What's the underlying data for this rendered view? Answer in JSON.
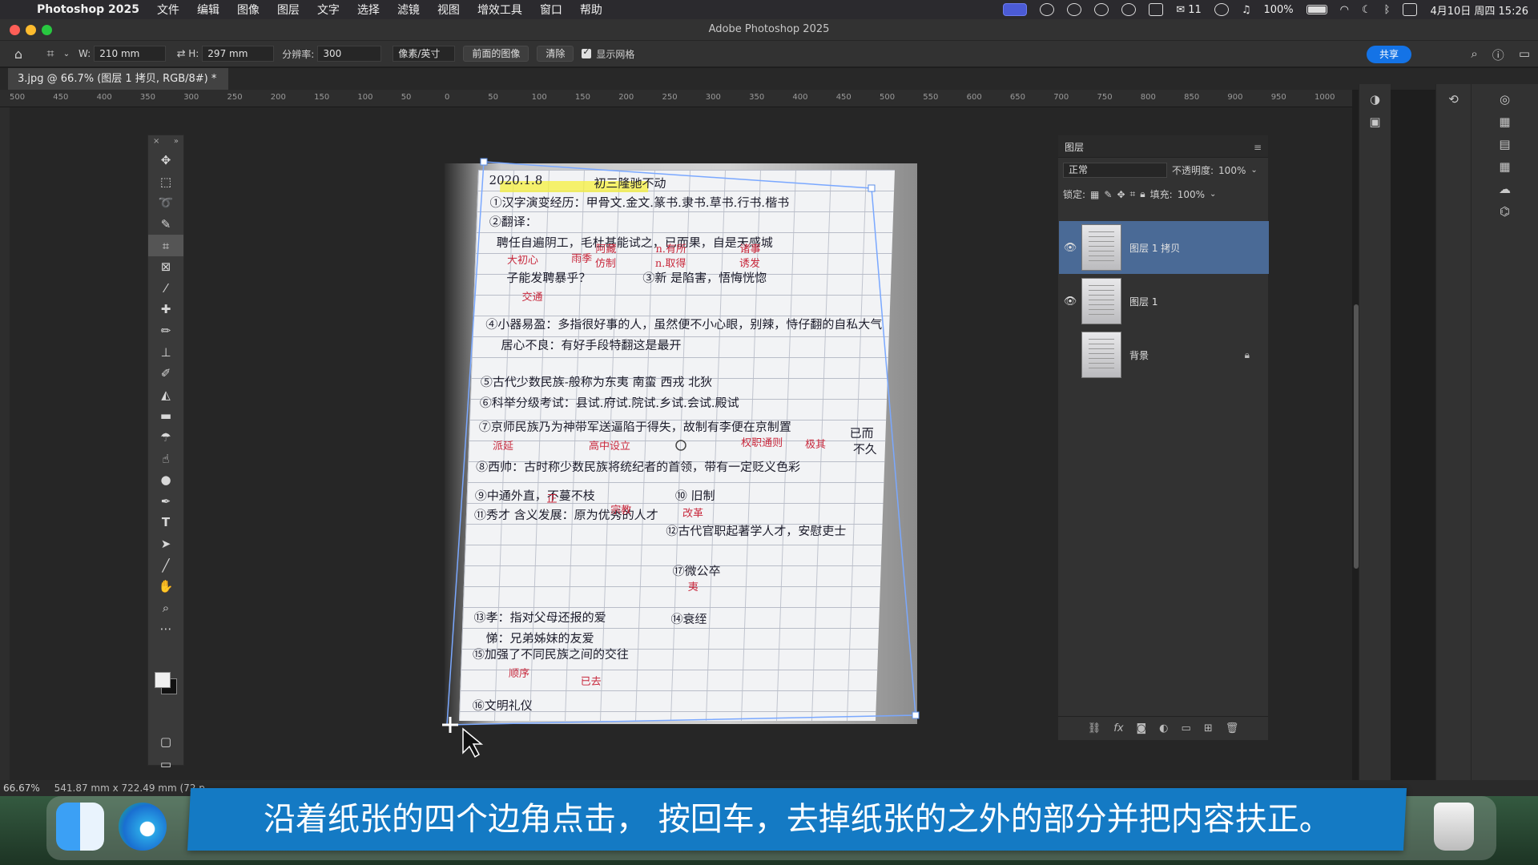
{
  "menubar": {
    "app_name": "Photoshop 2025",
    "menus": [
      "文件",
      "编辑",
      "图像",
      "图层",
      "文字",
      "选择",
      "滤镜",
      "视图",
      "增效工具",
      "窗口",
      "帮助"
    ],
    "wechat_count": "11",
    "battery": "100%",
    "datetime": "4月10日 周四 15:26"
  },
  "window": {
    "title": "Adobe Photoshop 2025"
  },
  "options": {
    "w_label": "W:",
    "w_value": "210 mm",
    "h_label": "H:",
    "h_value": "297 mm",
    "res_label": "分辨率:",
    "res_value": "300",
    "unit": "像素/英寸",
    "front_image": "前面的图像",
    "clear": "清除",
    "show_grid": "显示网格",
    "share": "共享"
  },
  "document": {
    "tab_title": "3.jpg @ 66.7% (图层 1 拷贝, RGB/8#) *"
  },
  "ruler": {
    "labels": [
      "500",
      "450",
      "400",
      "350",
      "300",
      "250",
      "200",
      "150",
      "100",
      "50",
      "0",
      "50",
      "100",
      "150",
      "200",
      "250",
      "300",
      "350",
      "400",
      "450",
      "500",
      "550",
      "600",
      "650",
      "700",
      "750",
      "800",
      "850",
      "900",
      "950",
      "1000"
    ]
  },
  "layers": {
    "tab": "图层",
    "blend_mode": "正常",
    "opacity_label": "不透明度:",
    "opacity_value": "100%",
    "lock_label": "锁定:",
    "fill_label": "填充:",
    "fill_value": "100%",
    "items": [
      {
        "name": "图层 1 拷贝",
        "visible": true,
        "selected": true
      },
      {
        "name": "图层 1",
        "visible": true,
        "selected": false
      },
      {
        "name": "背景",
        "visible": false,
        "selected": false,
        "locked": true
      }
    ]
  },
  "status": {
    "zoom": "66.67%",
    "dimensions": "541.87 mm x 722.49 mm (72 p"
  },
  "subtitle": "沿着纸张的四个边角点击， 按回车，去掉纸张的之外的部分并把内容扶正。",
  "notes": {
    "lines": [
      "2020.1.8",
      "初三隆驰不动",
      "①汉字演变经历：甲骨文.金文.篆书.隶书.草书.行书.楷书",
      "②翻译：",
      "聘任自遍阴工，毛杜甚能试之，已而果，自是天感城",
      "子能发聘暴乎？",
      "③新 是陷害，悟悔恍惚",
      "④小器易盈：多指很好事的人，虽然便不小心眼，别辣，恃仔翻的自私大气",
      "居心不良：有好手段特翻这是最开",
      "⑤古代少数民族-般称为东夷 南蛮 西戎 北狄",
      "⑥科举分级考试：县试.府试.院试.乡试.会试.殿试",
      "⑦京师民族乃为神带军送逼陷于得失，故制有李便在京制置",
      "⑧西帅：古时称少数民族将统纪者的首领，带有一定贬义色彩",
      "⑨中通外直，不蔓不枝",
      "⑩ 旧制",
      "⑪秀才 含义发展：原为优秀的人才",
      "⑫古代官职起著学人才，安慰吏士",
      "⑬孝：指对父母还报的爱",
      "悌：兄弟姊妹的友爱",
      "⑭衰绖",
      "⑮加强了不同民族之间的交往",
      "⑯文明礼仪",
      "⑰微公卒",
      "已而",
      "不久"
    ],
    "red": [
      "大初心",
      "雨季",
      "阿藏",
      "仿制",
      "n.有所",
      "n.取得",
      "诸事",
      "诱发",
      "交通",
      "派延",
      "高中设立",
      "权职通则",
      "极其",
      "改革",
      "夷",
      "宗教",
      "正",
      "顺序",
      "已去"
    ]
  }
}
